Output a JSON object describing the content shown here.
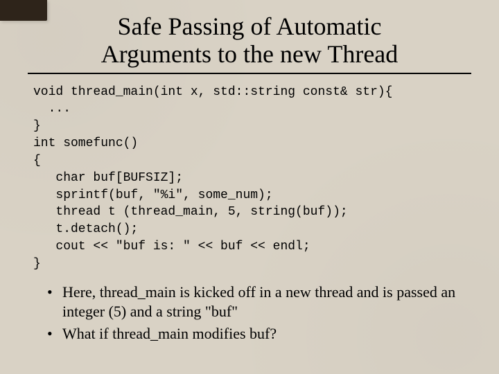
{
  "title_line1": "Safe Passing of Automatic",
  "title_line2": "Arguments to the new Thread",
  "code_lines": [
    "void thread_main(int x, std::string const& str){",
    "  ...",
    "}",
    "int somefunc()",
    "{",
    "   char buf[BUFSIZ];",
    "   sprintf(buf, \"%i\", some_num);",
    "   thread t (thread_main, 5, string(buf));",
    "   t.detach();",
    "   cout << \"buf is: \" << buf << endl;",
    "}"
  ],
  "bullets": [
    "Here, thread_main is kicked off in a new thread and is passed an integer (5) and a string \"buf\"",
    "What if thread_main modifies buf?"
  ]
}
